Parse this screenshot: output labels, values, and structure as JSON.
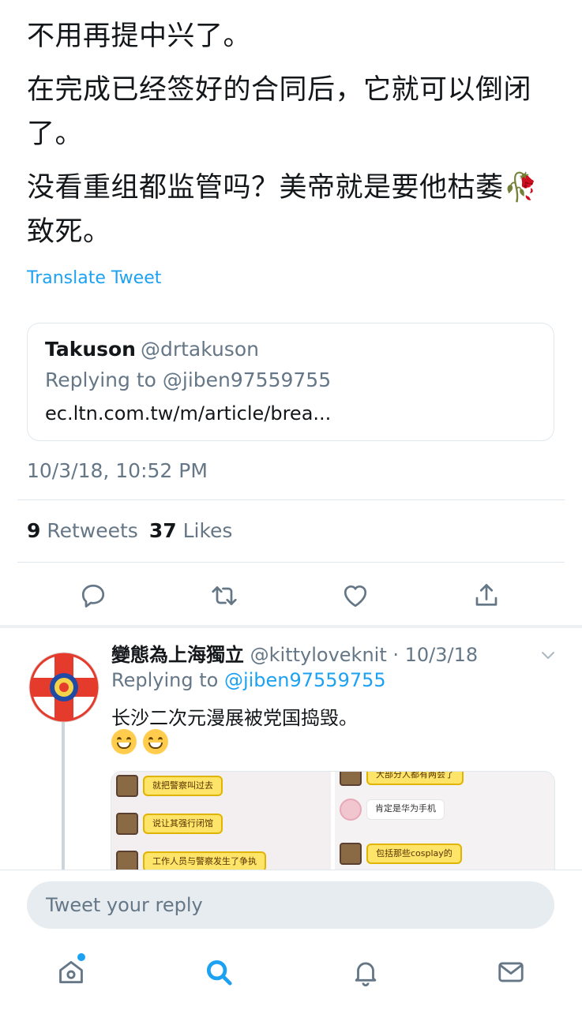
{
  "tweet": {
    "lines": [
      "不用再提中兴了。",
      "在完成已经签好的合同后，它就可以倒闭了。",
      "没看重组都监管吗？美帝就是要他枯萎🥀致死。"
    ],
    "translate_label": "Translate Tweet",
    "timestamp": "10/3/18, 10:52 PM"
  },
  "quoted": {
    "name": "Takuson",
    "handle": "@drtakuson",
    "replying_to": "Replying to @jiben97559755",
    "link_text": "ec.ltn.com.tw/m/article/brea..."
  },
  "stats": {
    "retweets_count": "9",
    "retweets_label": "Retweets",
    "likes_count": "37",
    "likes_label": "Likes"
  },
  "actions": {
    "icons": [
      "reply-icon",
      "retweet-icon",
      "like-icon",
      "share-icon"
    ]
  },
  "reply": {
    "name": "變態為上海獨立",
    "handle_date": "@kittyloveknit · 10/3/18",
    "replying_prefix": "Replying to",
    "replying_mention": "@jiben97559755",
    "text": "长沙二次元漫展被党国捣毁。",
    "emoji_count": 2,
    "media": {
      "left_bubbles": [
        "就把警察叫过去",
        "说让其强行闭馆",
        "工作人员与警察发生了争执"
      ],
      "right_bubbles": [
        "大部分人都有两会了",
        "肯定是华为手机",
        "包括那些cosplay的"
      ]
    }
  },
  "composer": {
    "placeholder": "Tweet your reply"
  },
  "tabbar": {
    "icons": [
      "home-icon",
      "search-icon",
      "notifications-icon",
      "messages-icon"
    ],
    "active": "search-icon"
  },
  "colors": {
    "accent": "#1da1f2",
    "text": "#14171a",
    "muted": "#657786",
    "border": "#e1e8ed"
  }
}
